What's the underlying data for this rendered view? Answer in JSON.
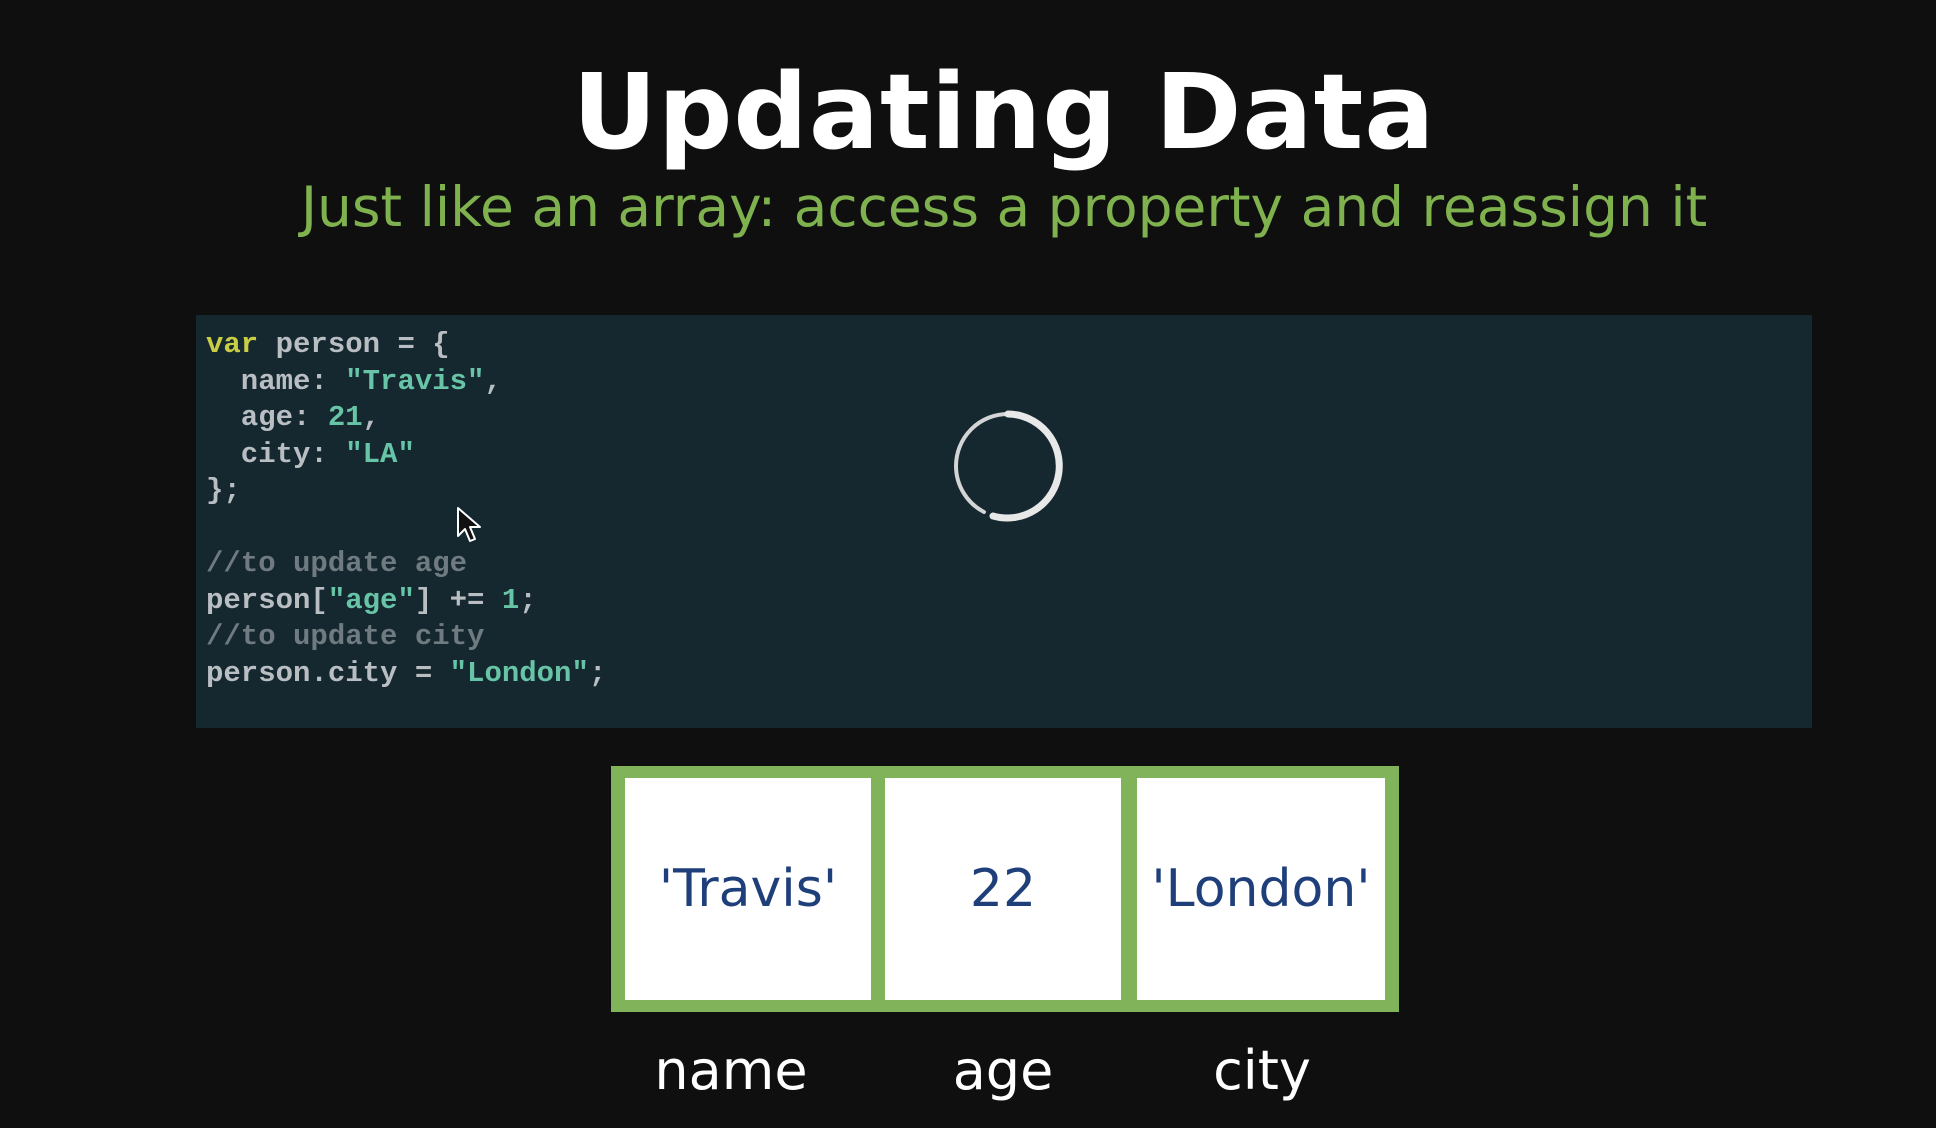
{
  "slide": {
    "title": "Updating Data",
    "subtitle": "Just like an array: access a property and reassign it"
  },
  "code": {
    "lines": [
      [
        {
          "t": "var",
          "c": "kw"
        },
        {
          "t": " person = {",
          "c": ""
        }
      ],
      [
        {
          "t": "  name: ",
          "c": ""
        },
        {
          "t": "\"Travis\"",
          "c": "str"
        },
        {
          "t": ",",
          "c": ""
        }
      ],
      [
        {
          "t": "  age: ",
          "c": ""
        },
        {
          "t": "21",
          "c": "num"
        },
        {
          "t": ",",
          "c": ""
        }
      ],
      [
        {
          "t": "  city: ",
          "c": ""
        },
        {
          "t": "\"LA\"",
          "c": "str"
        }
      ],
      [
        {
          "t": "};",
          "c": ""
        }
      ],
      [],
      [
        {
          "t": "//to update age",
          "c": "cmt"
        }
      ],
      [
        {
          "t": "person[",
          "c": ""
        },
        {
          "t": "\"age\"",
          "c": "str"
        },
        {
          "t": "] += ",
          "c": ""
        },
        {
          "t": "1",
          "c": "num"
        },
        {
          "t": ";",
          "c": ""
        }
      ],
      [
        {
          "t": "//to update city",
          "c": "cmt"
        }
      ],
      [
        {
          "t": "person.city = ",
          "c": ""
        },
        {
          "t": "\"London\"",
          "c": "str"
        },
        {
          "t": ";",
          "c": ""
        }
      ]
    ]
  },
  "diagram": {
    "values": [
      "'Travis'",
      "22",
      "'London'"
    ],
    "keys": [
      "name",
      "age",
      "city"
    ]
  },
  "overlay": {
    "spinner_icon": "loading-spinner-icon",
    "cursor_icon": "mouse-pointer-icon"
  },
  "colors": {
    "background": "#0f0f0f",
    "title": "#ffffff",
    "subtitle": "#7fb24f",
    "code_panel": "#15272f",
    "keyword": "#c9cd43",
    "string": "#67c4a7",
    "comment": "#6f7b80",
    "box_border": "#80b35a",
    "box_text": "#1f3f7a"
  }
}
